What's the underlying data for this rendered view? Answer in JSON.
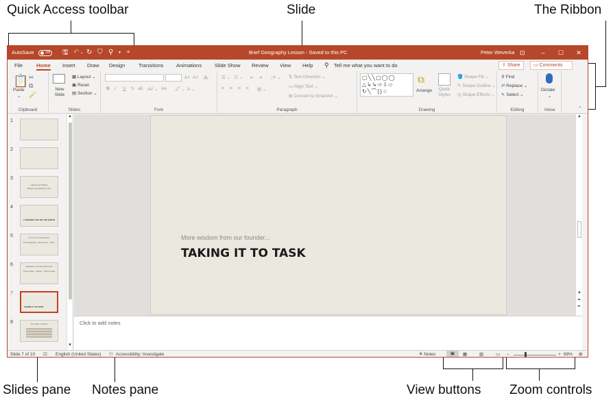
{
  "callouts": {
    "quick_access": "Quick Access toolbar",
    "slide": "Slide",
    "ribbon": "The Ribbon",
    "slides_pane": "Slides pane",
    "notes_pane": "Notes pane",
    "view_buttons": "View buttons",
    "zoom_controls": "Zoom controls"
  },
  "titlebar": {
    "autosave_label": "AutoSave",
    "autosave_state": "Off",
    "document_title": "Brief Geography Lesson - Saved to this PC",
    "user_name": "Peter Weverka",
    "minimize": "–",
    "restore": "☐",
    "close": "✕"
  },
  "menu": {
    "tabs": [
      "File",
      "Home",
      "Insert",
      "Draw",
      "Design",
      "Transitions",
      "Animations",
      "Slide Show",
      "Review",
      "View",
      "Help"
    ],
    "active_tab": "Home",
    "search_placeholder": "Tell me what you want to do",
    "share_label": "Share",
    "comments_label": "Comments"
  },
  "ribbon": {
    "clipboard": {
      "label": "Clipboard",
      "paste": "Paste"
    },
    "slides": {
      "label": "Slides",
      "new_slide": "New Slide",
      "layout": "Layout",
      "reset": "Reset",
      "section": "Section"
    },
    "font": {
      "label": "Font",
      "bold": "B",
      "italic": "I",
      "underline": "U",
      "strike": "S",
      "change_case": "Aa"
    },
    "paragraph": {
      "label": "Paragraph",
      "text_direction": "Text Direction",
      "align_text": "Align Text",
      "convert_smartart": "Convert to SmartArt"
    },
    "drawing": {
      "label": "Drawing",
      "arrange": "Arrange",
      "quick_styles": "Quick Styles",
      "shape_fill": "Shape Fill",
      "shape_outline": "Shape Outline",
      "shape_effects": "Shape Effects"
    },
    "editing": {
      "label": "Editing",
      "find": "Find",
      "replace": "Replace",
      "select": "Select"
    },
    "voice": {
      "label": "Voice",
      "dictate": "Dictate"
    }
  },
  "slides_pane": {
    "thumbnails": [
      {
        "number": "1",
        "title": "",
        "lines": ""
      },
      {
        "number": "2",
        "title": "",
        "lines": ""
      },
      {
        "number": "3",
        "title": "Lightening facilities",
        "lines": "Bringing geography to life"
      },
      {
        "number": "4",
        "title": "",
        "lines": "A SHARED LIFE ON THE EARTH"
      },
      {
        "number": "5",
        "title": "Our first considerations",
        "lines": "Demographics · Resources · Climate · Trade routes"
      },
      {
        "number": "6",
        "title": "Sanitation & Smart Take Note",
        "lines": "Clean water · Waste · Public health · Education"
      },
      {
        "number": "7",
        "title": "",
        "lines": "TAKING IT TO TASK"
      },
      {
        "number": "8",
        "title": "The Way It Stands",
        "lines": ""
      }
    ],
    "selected_index": 6
  },
  "slide": {
    "subtitle": "More wisdom from our founder...",
    "title": "TAKING IT TO TASK"
  },
  "notes": {
    "placeholder": "Click to add notes"
  },
  "statusbar": {
    "slide_count": "Slide 7 of 10",
    "language": "English (United States)",
    "accessibility": "Accessibility: Investigate",
    "notes_label": "Notes",
    "zoom_percent": "69%"
  },
  "colors": {
    "accent": "#b7472a",
    "slide_background": "#ebe8e0",
    "selected_thumbnail_border": "#c43e1c"
  }
}
